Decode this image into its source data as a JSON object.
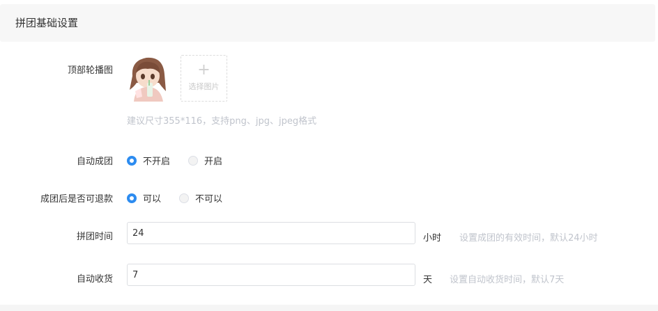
{
  "section": {
    "title": "拼团基础设置"
  },
  "banner": {
    "label": "顶部轮播图",
    "upload_label": "选择图片",
    "upload_plus": "+",
    "hint": "建议尺寸355*116，支持png、jpg、jpeg格式"
  },
  "auto_group": {
    "label": "自动成团",
    "options": [
      {
        "label": "不开启",
        "checked": true
      },
      {
        "label": "开启",
        "checked": false
      }
    ]
  },
  "refund": {
    "label": "成团后是否可退款",
    "options": [
      {
        "label": "可以",
        "checked": true
      },
      {
        "label": "不可以",
        "checked": false
      }
    ]
  },
  "group_time": {
    "label": "拼团时间",
    "value": "24",
    "unit": "小时",
    "hint": "设置成团的有效时间，默认24小时"
  },
  "auto_receive": {
    "label": "自动收货",
    "value": "7",
    "unit": "天",
    "hint": "设置自动收货时间，默认7天"
  },
  "colors": {
    "accent": "#2d8cf0",
    "hint": "#c0c4cc",
    "header_bg": "#f7f7f7"
  }
}
